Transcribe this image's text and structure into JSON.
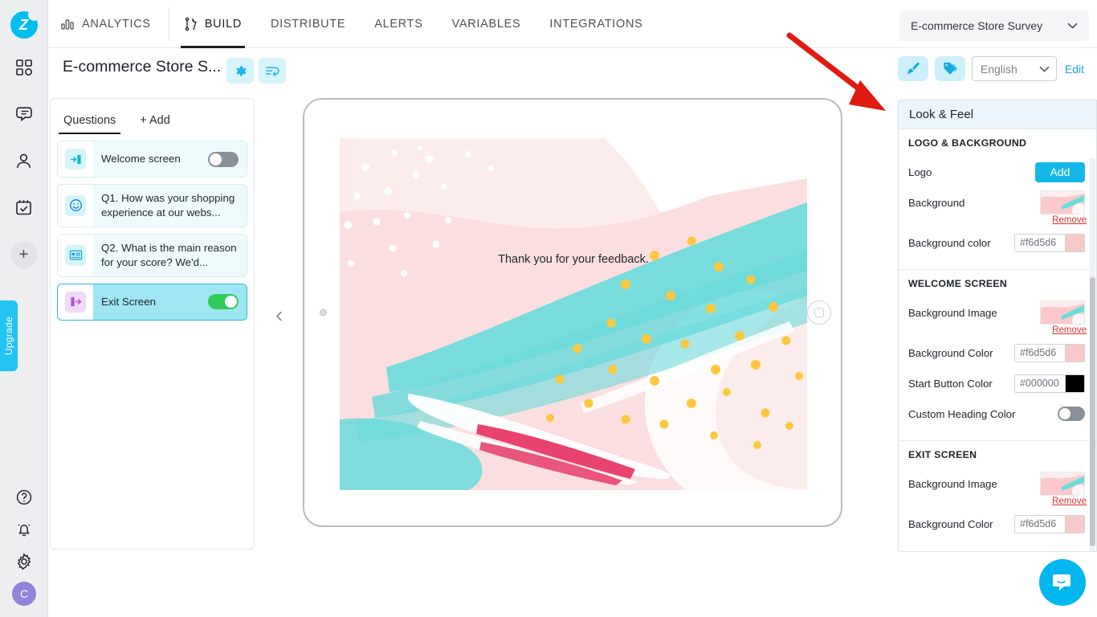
{
  "rail": {
    "logo_letter": "Z",
    "items": [
      {
        "name": "dashboard-icon",
        "label": "Dashboard"
      },
      {
        "name": "feedback-icon",
        "label": "Feedback"
      },
      {
        "name": "contacts-icon",
        "label": "Contacts"
      },
      {
        "name": "tasks-icon",
        "label": "Tasks"
      }
    ],
    "plus_label": "+",
    "upgrade_label": "Upgrade",
    "bottom": [
      {
        "name": "help-icon",
        "label": "Help"
      },
      {
        "name": "notifications-icon",
        "label": "Notifications"
      },
      {
        "name": "settings-icon",
        "label": "Settings"
      }
    ],
    "avatar_initial": "C"
  },
  "topnav": {
    "tabs": [
      {
        "label": "ANALYTICS",
        "icon": "bar-chart-icon",
        "active": false
      },
      {
        "label": "BUILD",
        "icon": "tools-icon",
        "active": true
      },
      {
        "label": "DISTRIBUTE",
        "icon": "",
        "active": false
      },
      {
        "label": "ALERTS",
        "icon": "",
        "active": false
      },
      {
        "label": "VARIABLES",
        "icon": "",
        "active": false
      },
      {
        "label": "INTEGRATIONS",
        "icon": "",
        "active": false
      }
    ],
    "survey_selector": "E-commerce Store Survey"
  },
  "survey_header": {
    "title": "E-commerce Store S...",
    "gear_button": "settings",
    "logic_button": "logic",
    "brush_button": "look-and-feel",
    "tag_button": "tags",
    "language": "English",
    "edit_label": "Edit"
  },
  "questions_panel": {
    "tabs": [
      {
        "label": "Questions",
        "active": true
      },
      {
        "label": "+ Add",
        "active": false
      }
    ],
    "items": [
      {
        "label": "Welcome screen",
        "icon": "welcome-screen-icon",
        "toggle": "off",
        "selected": false,
        "icon_bg": "#d5f6f9",
        "icon_color": "#1cb6cf"
      },
      {
        "label": "Q1. How was your shopping experience at our webs...",
        "icon": "smiley-icon",
        "toggle": "none",
        "selected": false,
        "icon_bg": "#d5f6f9",
        "icon_color": "#1b7fe0"
      },
      {
        "label": "Q2. What is the main reason for your score? We'd...",
        "icon": "text-field-icon",
        "toggle": "none",
        "selected": false,
        "icon_bg": "#d5f6f9",
        "icon_color": "#1b9ed6"
      },
      {
        "label": "Exit Screen",
        "icon": "exit-screen-icon",
        "toggle": "on",
        "selected": true,
        "icon_bg": "#f0d9f7",
        "icon_color": "#b14fd8"
      }
    ]
  },
  "preview": {
    "thank_you_text": "Thank you for your feedback.",
    "prev_arrow": "‹",
    "background_pink": "#fbdfe0",
    "background_pink_light": "#fdecec",
    "teal": "#6ddbdb",
    "yellow": "#fcc83d",
    "magenta": "#e8436e"
  },
  "look_and_feel": {
    "panel_title": "Look & Feel",
    "sections": [
      {
        "title": "LOGO & BACKGROUND",
        "rows": [
          {
            "label": "Logo",
            "type": "button",
            "value": "Add"
          },
          {
            "label": "Background",
            "type": "image",
            "value": "Remove"
          },
          {
            "label": "Background color",
            "type": "color",
            "value": "#f6d5d6",
            "swatch": "#f8c9c9"
          }
        ]
      },
      {
        "title": "WELCOME SCREEN",
        "rows": [
          {
            "label": "Background Image",
            "type": "image",
            "value": "Remove"
          },
          {
            "label": "Background Color",
            "type": "color",
            "value": "#f6d5d6",
            "swatch": "#f8c9c9"
          },
          {
            "label": "Start Button Color",
            "type": "color",
            "value": "#000000",
            "swatch": "#000000"
          },
          {
            "label": "Custom Heading Color",
            "type": "toggle",
            "value": "off"
          }
        ]
      },
      {
        "title": "EXIT SCREEN",
        "rows": [
          {
            "label": "Background Image",
            "type": "image",
            "value": "Remove"
          },
          {
            "label": "Background Color",
            "type": "color",
            "value": "#f6d5d6",
            "swatch": "#f8c9c9"
          }
        ]
      }
    ]
  },
  "annotation": {
    "arrow_color": "#e01b12"
  },
  "chat": {
    "icon": "chat-bubble-icon",
    "color": "#00b6ef"
  }
}
